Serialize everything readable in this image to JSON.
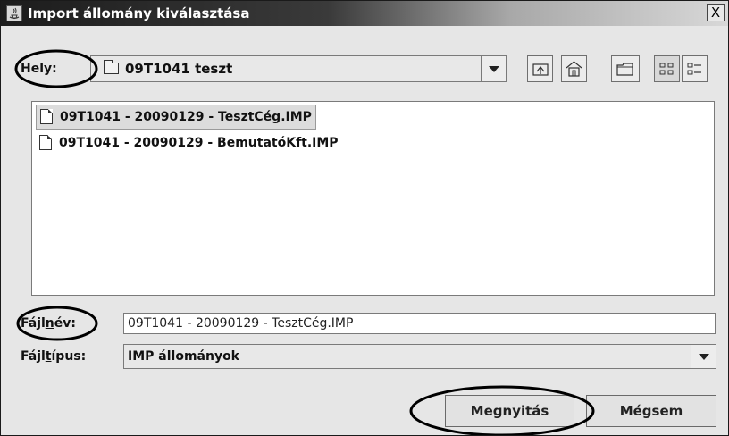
{
  "window": {
    "title": "Import állomány kiválasztása",
    "close_label": "X"
  },
  "lookin": {
    "label": "Hely:",
    "value": "09T1041 teszt"
  },
  "toolbar": {
    "icons": [
      "up-folder-icon",
      "home-icon",
      "new-folder-icon",
      "list-view-icon",
      "details-view-icon"
    ]
  },
  "files": [
    {
      "name": "09T1041 - 20090129 - TesztCég.IMP",
      "selected": true
    },
    {
      "name": "09T1041 - 20090129 - BemutatóKft.IMP",
      "selected": false
    }
  ],
  "filename": {
    "label_pre": "Fájl",
    "label_ul": "n",
    "label_post": "év:",
    "value": "09T1041 - 20090129 - TesztCég.IMP"
  },
  "filetype": {
    "label_pre": "Fájl",
    "label_ul": "t",
    "label_post": "ípus:",
    "value": "IMP állományok"
  },
  "buttons": {
    "open": "Megnyitás",
    "cancel": "Mégsem"
  },
  "colors": {
    "dialog_bg": "#e6e6e6",
    "titlebar_dark": "#1c1c1c",
    "selection_bg": "#dcdcdc"
  }
}
